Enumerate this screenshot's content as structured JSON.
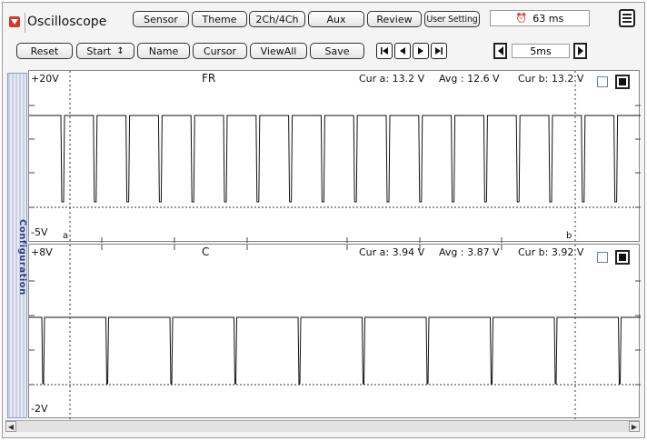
{
  "header": {
    "title": "Oscilloscope",
    "buttons": [
      "Sensor",
      "Theme",
      "2Ch/4Ch",
      "Aux",
      "Review",
      "User Setting"
    ],
    "time_value": "63 ms"
  },
  "toolbar": {
    "reset": "Reset",
    "start": "Start",
    "start_arrow": "↕",
    "name": "Name",
    "cursor": "Cursor",
    "viewall": "ViewAll",
    "save": "Save",
    "timebase": "5ms"
  },
  "sidebar": {
    "label": "Configuration"
  },
  "channels": [
    {
      "name": "FR",
      "top_label": "+20V",
      "bottom_label": "-5V",
      "cursor_a": "Cur a: 13.2 V",
      "avg": "Avg  : 12.6 V",
      "cursor_b": "Cur b: 13.2 V",
      "marker_a": "a",
      "marker_b": "b"
    },
    {
      "name": "C",
      "top_label": "+8V",
      "bottom_label": "-2V",
      "cursor_a": "Cur a: 3.94 V",
      "avg": "Avg  : 3.87 V",
      "cursor_b": "Cur b: 3.92 V"
    }
  ],
  "colors": {
    "accent": "#d23a2a",
    "sidebar": "#c8d0e4",
    "trace": "#111111"
  }
}
